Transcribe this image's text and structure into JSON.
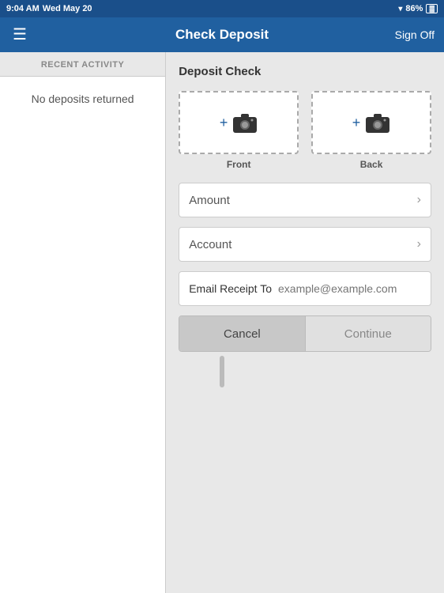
{
  "status_bar": {
    "time": "9:04 AM",
    "date": "Wed May 20",
    "battery": "86%"
  },
  "nav": {
    "menu_icon": "☰",
    "title": "Check Deposit",
    "sign_off_label": "Sign Off"
  },
  "left_panel": {
    "recent_activity_label": "RECENT ACTIVITY",
    "no_deposits_label": "No deposits returned"
  },
  "right_panel": {
    "deposit_check_title": "Deposit Check",
    "front_label": "Front",
    "back_label": "Back",
    "amount_label": "Amount",
    "account_label": "Account",
    "email_label": "Email Receipt To",
    "email_placeholder": "example@example.com",
    "cancel_label": "Cancel",
    "continue_label": "Continue"
  }
}
